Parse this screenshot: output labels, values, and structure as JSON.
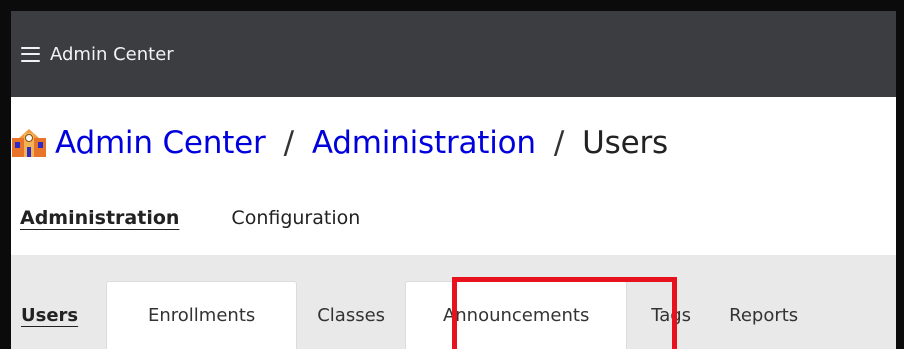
{
  "topbar": {
    "menu_icon": "hamburger-menu-icon",
    "title": "Admin Center"
  },
  "breadcrumb": {
    "logo_icon": "school-building-icon",
    "items": [
      "Admin Center",
      "Administration"
    ],
    "separator": "/",
    "current": "Users"
  },
  "section_nav": {
    "items": [
      "Administration",
      "Configuration"
    ],
    "active": "Administration"
  },
  "tabs": {
    "items": [
      "Users",
      "Enrollments",
      "Classes",
      "Announcements",
      "Tags",
      "Reports"
    ],
    "active": "Users",
    "highlighted": "Announcements"
  },
  "colors": {
    "topbar_bg": "#3b3d40",
    "link": "#0000dd",
    "highlight": "#e8121e",
    "band": "#e9e9e9"
  }
}
